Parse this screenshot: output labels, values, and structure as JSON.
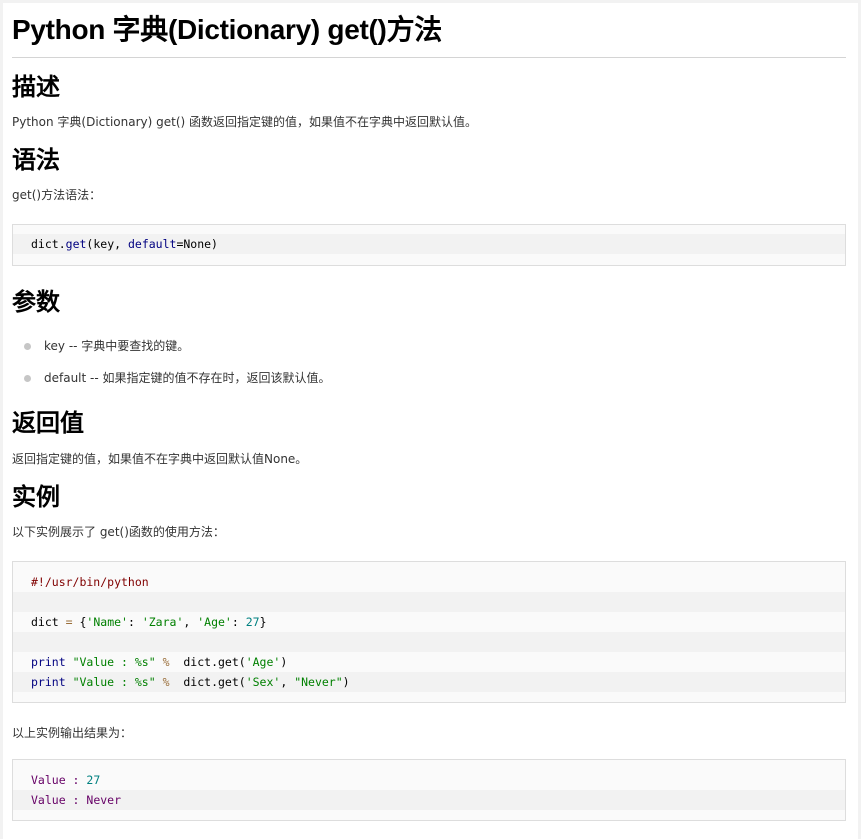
{
  "title": "Python 字典(Dictionary) get()方法",
  "sections": {
    "description": {
      "heading": "描述",
      "text": "Python 字典(Dictionary) get() 函数返回指定键的值，如果值不在字典中返回默认值。"
    },
    "syntax": {
      "heading": "语法",
      "intro": "get()方法语法：",
      "code": {
        "obj": "dict",
        "dot": ".",
        "fn": "get",
        "open": "(key, ",
        "kw": "default",
        "eq": "=None)"
      }
    },
    "params": {
      "heading": "参数",
      "items": [
        {
          "text": "key -- 字典中要查找的键。"
        },
        {
          "text": "default -- 如果指定键的值不存在时，返回该默认值。"
        }
      ]
    },
    "returns": {
      "heading": "返回值",
      "text": "返回指定键的值，如果值不在字典中返回默认值None。"
    },
    "example": {
      "heading": "实例",
      "intro": "以下实例展示了 get()函数的使用方法：",
      "code": {
        "shebang": "#!/usr/bin/python",
        "l2_var": "dict ",
        "l2_eq": "=",
        "l2_open": " {",
        "l2_k1": "'Name'",
        "l2_c1": ": ",
        "l2_v1": "'Zara'",
        "l2_sep": ", ",
        "l2_k2": "'Age'",
        "l2_c2": ": ",
        "l2_v2": "27",
        "l2_close": "}",
        "print": "print",
        "fmt": "\"Value : %s\"",
        "pct": "%",
        "call": "  dict.get(",
        "arg1": "'Age'",
        "close1": ")",
        "arg2a": "'Sex'",
        "comma": ", ",
        "arg2b": "\"Never\"",
        "close2": ")"
      },
      "output_intro": "以上实例输出结果为：",
      "output": {
        "l1_label": "Value : ",
        "l1_val": "27",
        "l2_label": "Value : ",
        "l2_val": "Never"
      }
    }
  }
}
